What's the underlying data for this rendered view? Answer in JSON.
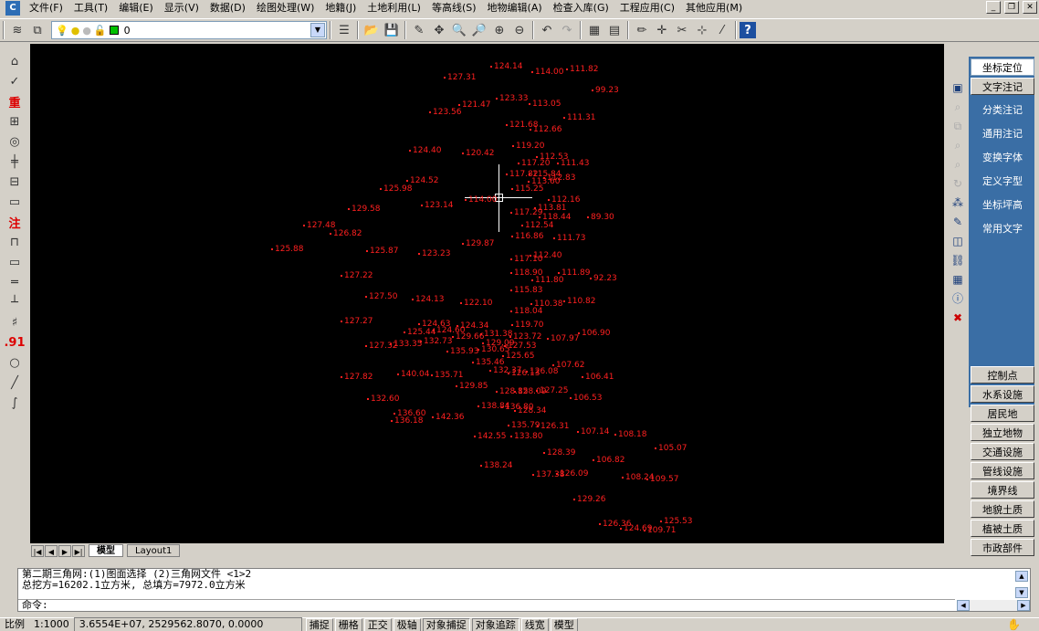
{
  "menu": [
    "文件(F)",
    "工具(T)",
    "编辑(E)",
    "显示(V)",
    "数据(D)",
    "绘图处理(W)",
    "地籍(J)",
    "土地利用(L)",
    "等高线(S)",
    "地物编辑(A)",
    "检查入库(G)",
    "工程应用(C)",
    "其他应用(M)"
  ],
  "toolbar": {
    "layer_value": "0",
    "layer_icons": [
      "lightbulb-icon",
      "sun-icon",
      "lock-icon",
      "color-square-icon"
    ]
  },
  "tabs": {
    "model": "模型",
    "layout1": "Layout1"
  },
  "right_panel": {
    "top_buttons": [
      "坐标定位",
      "文字注记"
    ],
    "blue_items": [
      "分类注记",
      "通用注记",
      "变换字体",
      "定义字型",
      "坐标坪高",
      "常用文字"
    ],
    "bottom_buttons": [
      "控制点",
      "水系设施",
      "居民地",
      "独立地物",
      "交通设施",
      "管线设施",
      "境界线",
      "地貌土质",
      "植被土质",
      "市政部件"
    ]
  },
  "command": {
    "line1": "第二期三角网:(1)图面选择 (2)三角网文件 <1>2",
    "line2": "总挖方=16202.1立方米, 总填方=7972.0立方米",
    "prompt": "命令:"
  },
  "status": {
    "scale_label": "比例",
    "scale": "1:1000",
    "coords": "3.6554E+07, 2529562.8070, 0.0000",
    "buttons": [
      "捕捉",
      "栅格",
      "正交",
      "极轴",
      "对象捕捉",
      "对象追踪",
      "线宽",
      "模型"
    ]
  },
  "points": [
    {
      "v": "124.14",
      "c": "pt-a"
    },
    {
      "v": "114.00",
      "c": "pt-b"
    },
    {
      "v": "111.82",
      "c": "pt-c"
    },
    {
      "v": "127.31",
      "c": "pt-d"
    },
    {
      "v": "99.23",
      "c": "pt-e"
    },
    {
      "v": "123.33",
      "c": "pt-f"
    },
    {
      "v": "113.05",
      "c": "pt-g"
    },
    {
      "v": "121.47",
      "c": "pt-h"
    },
    {
      "v": "123.56",
      "c": "pt-i"
    },
    {
      "v": "111.31",
      "c": "pt-j"
    },
    {
      "v": "121.68",
      "c": "pt-k"
    },
    {
      "v": "112.66",
      "c": "pt-l"
    },
    {
      "v": "119.20",
      "c": "pt-m"
    },
    {
      "v": "124.40",
      "c": "pt-n"
    },
    {
      "v": "120.42",
      "c": "pt-o"
    },
    {
      "v": "112.53",
      "c": "pt-p"
    },
    {
      "v": "117.20",
      "c": "pt-q"
    },
    {
      "v": "111.43",
      "c": "pt-r"
    },
    {
      "v": "117.82",
      "c": "pt-s"
    },
    {
      "v": "115.84",
      "c": "pt-t"
    },
    {
      "v": "112.83",
      "c": "pt-u"
    },
    {
      "v": "124.52",
      "c": "pt-v"
    },
    {
      "v": "113.60",
      "c": "pt-w"
    },
    {
      "v": "125.98",
      "c": "pt-x"
    },
    {
      "v": "115.25",
      "c": "pt-y"
    },
    {
      "v": "112.16",
      "c": "pt-z"
    },
    {
      "v": "129.58",
      "c": "pt-aa"
    },
    {
      "v": "123.14",
      "c": "pt-ab"
    },
    {
      "v": "113.81",
      "c": "pt-ac"
    },
    {
      "v": "117.29",
      "c": "pt-ad"
    },
    {
      "v": "89.30",
      "c": "pt-ae"
    },
    {
      "v": "127.48",
      "c": "pt-af"
    },
    {
      "v": "112.54",
      "c": "pt-ag"
    },
    {
      "v": "126.82",
      "c": "pt-ah"
    },
    {
      "v": "116.86",
      "c": "pt-ai"
    },
    {
      "v": "111.73",
      "c": "pt-aj"
    },
    {
      "v": "125.88",
      "c": "pt-ak"
    },
    {
      "v": "129.87",
      "c": "pt-al"
    },
    {
      "v": "125.87",
      "c": "pt-am"
    },
    {
      "v": "123.23",
      "c": "pt-an"
    },
    {
      "v": "112.40",
      "c": "pt-ao"
    },
    {
      "v": "117.10",
      "c": "pt-ap"
    },
    {
      "v": "111.89",
      "c": "pt-aq"
    },
    {
      "v": "118.90",
      "c": "pt-ar"
    },
    {
      "v": "92.23",
      "c": "pt-as"
    },
    {
      "v": "127.22",
      "c": "pt-at"
    },
    {
      "v": "111.80",
      "c": "pt-au"
    },
    {
      "v": "115.83",
      "c": "pt-av"
    },
    {
      "v": "127.50",
      "c": "pt-aw"
    },
    {
      "v": "124.13",
      "c": "pt-ax"
    },
    {
      "v": "122.10",
      "c": "pt-ay"
    },
    {
      "v": "110.38",
      "c": "pt-az"
    },
    {
      "v": "110.82",
      "c": "pt-ba"
    },
    {
      "v": "118.04",
      "c": "pt-bb"
    },
    {
      "v": "127.27",
      "c": "pt-bc"
    },
    {
      "v": "124.63",
      "c": "pt-bd"
    },
    {
      "v": "124.34",
      "c": "pt-be"
    },
    {
      "v": "119.70",
      "c": "pt-bf"
    },
    {
      "v": "125.44",
      "c": "pt-bg"
    },
    {
      "v": "124.60",
      "c": "pt-bh"
    },
    {
      "v": "131.38",
      "c": "pt-bi"
    },
    {
      "v": "106.90",
      "c": "pt-bj"
    },
    {
      "v": "129.66",
      "c": "pt-bk"
    },
    {
      "v": "123.72",
      "c": "pt-bl"
    },
    {
      "v": "107.97",
      "c": "pt-bm"
    },
    {
      "v": "132.73",
      "c": "pt-bn"
    },
    {
      "v": "129.09",
      "c": "pt-bo"
    },
    {
      "v": "127.53",
      "c": "pt-bp"
    },
    {
      "v": "127.32",
      "c": "pt-bq"
    },
    {
      "v": "133.35",
      "c": "pt-br"
    },
    {
      "v": "130.65",
      "c": "pt-bs"
    },
    {
      "v": "135.93",
      "c": "pt-bt"
    },
    {
      "v": "125.65",
      "c": "pt-bu"
    },
    {
      "v": "135.46",
      "c": "pt-bv"
    },
    {
      "v": "107.62",
      "c": "pt-bw"
    },
    {
      "v": "132.37",
      "c": "pt-bx"
    },
    {
      "v": "126.13",
      "c": "pt-by"
    },
    {
      "v": "126.08",
      "c": "pt-bz"
    },
    {
      "v": "127.82",
      "c": "pt-ca"
    },
    {
      "v": "140.04",
      "c": "pt-cb"
    },
    {
      "v": "135.71",
      "c": "pt-cc"
    },
    {
      "v": "106.41",
      "c": "pt-cd"
    },
    {
      "v": "129.85",
      "c": "pt-ce"
    },
    {
      "v": "128.85",
      "c": "pt-cf"
    },
    {
      "v": "128.09",
      "c": "pt-cg"
    },
    {
      "v": "127.25",
      "c": "pt-ch"
    },
    {
      "v": "132.60",
      "c": "pt-ci"
    },
    {
      "v": "106.53",
      "c": "pt-cj"
    },
    {
      "v": "138.84",
      "c": "pt-ck"
    },
    {
      "v": "136.80",
      "c": "pt-cl"
    },
    {
      "v": "128.34",
      "c": "pt-cm"
    },
    {
      "v": "136.60",
      "c": "pt-cn"
    },
    {
      "v": "142.36",
      "c": "pt-co"
    },
    {
      "v": "136.18",
      "c": "pt-cp"
    },
    {
      "v": "135.79",
      "c": "pt-cq"
    },
    {
      "v": "126.31",
      "c": "pt-cr"
    },
    {
      "v": "107.14",
      "c": "pt-cs"
    },
    {
      "v": "108.18",
      "c": "pt-ct"
    },
    {
      "v": "142.55",
      "c": "pt-cu"
    },
    {
      "v": "133.80",
      "c": "pt-cv"
    },
    {
      "v": "105.07",
      "c": "pt-cw"
    },
    {
      "v": "128.39",
      "c": "pt-cx"
    },
    {
      "v": "106.82",
      "c": "pt-cy"
    },
    {
      "v": "138.24",
      "c": "pt-cz"
    },
    {
      "v": "137.38",
      "c": "pt-da"
    },
    {
      "v": "126.09",
      "c": "pt-db"
    },
    {
      "v": "108.24",
      "c": "pt-dc"
    },
    {
      "v": "109.57",
      "c": "pt-dd"
    },
    {
      "v": "129.26",
      "c": "pt-de"
    },
    {
      "v": "126.36",
      "c": "pt-df"
    },
    {
      "v": "125.53",
      "c": "pt-dg"
    },
    {
      "v": "124.69",
      "c": "pt-dh"
    },
    {
      "v": "109.71",
      "c": "pt-di"
    },
    {
      "v": "114.00",
      "c": "pt-dj"
    },
    {
      "v": "118.44",
      "c": "pt-dk"
    }
  ]
}
